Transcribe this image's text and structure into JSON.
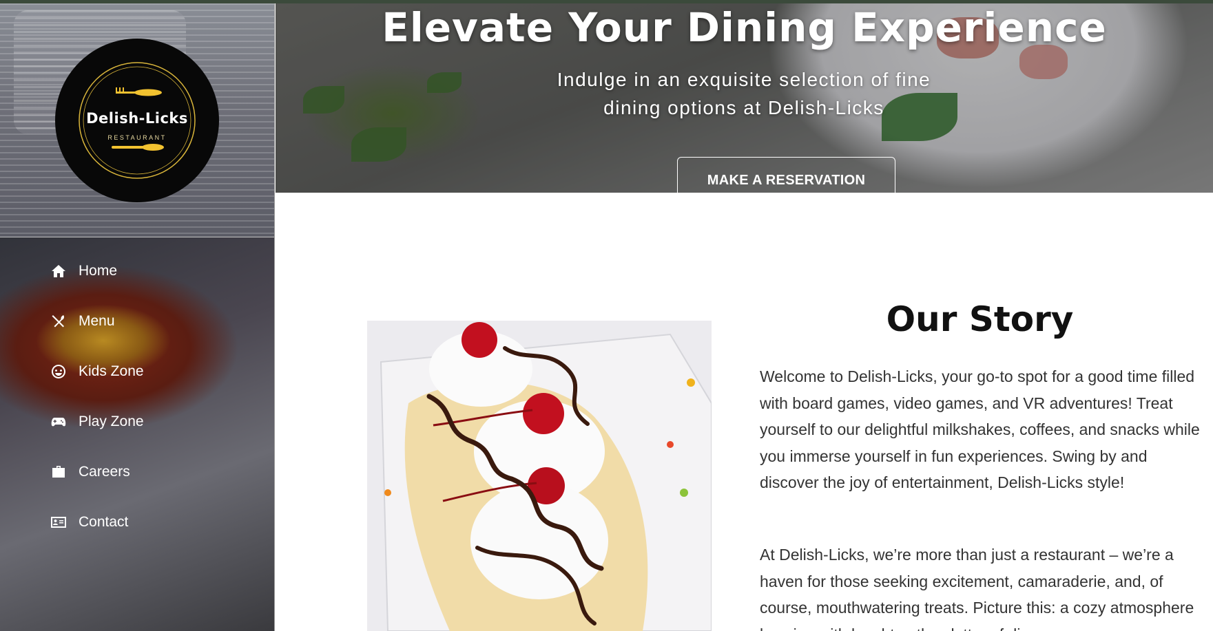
{
  "brand": {
    "name": "Delish-Licks",
    "tagline": "RESTAURANT"
  },
  "sidebar": {
    "items": [
      {
        "label": "Home",
        "icon": "home-icon"
      },
      {
        "label": "Menu",
        "icon": "utensils-icon"
      },
      {
        "label": "Kids Zone",
        "icon": "smile-icon"
      },
      {
        "label": "Play Zone",
        "icon": "gamepad-icon"
      },
      {
        "label": "Careers",
        "icon": "briefcase-icon"
      },
      {
        "label": "Contact",
        "icon": "contact-card-icon"
      }
    ]
  },
  "hero": {
    "title": "Elevate Your Dining Experience",
    "subtitle": "Indulge in an exquisite selection of fine dining options at Delish-Licks",
    "button_label": "MAKE A RESERVATION"
  },
  "story": {
    "title": "Our Story",
    "paragraphs": [
      "Welcome to Delish-Licks, your go-to spot for a good time filled with board games, video games, and VR adventures! Treat yourself to our delightful milkshakes, coffees, and snacks while you immerse yourself in fun experiences. Swing by and discover the joy of entertainment, Delish-Licks style!",
      "At Delish-Licks, we’re more than just a restaurant – we’re a haven for those seeking excitement, camaraderie, and, of course, mouthwatering treats. Picture this: a cozy atmosphere buzzing with laughter, the clatter of dice"
    ]
  },
  "colors": {
    "logo_background": "#080808",
    "logo_gold": "#f2c230",
    "text_dark": "#333333",
    "heading_dark": "#111111"
  }
}
